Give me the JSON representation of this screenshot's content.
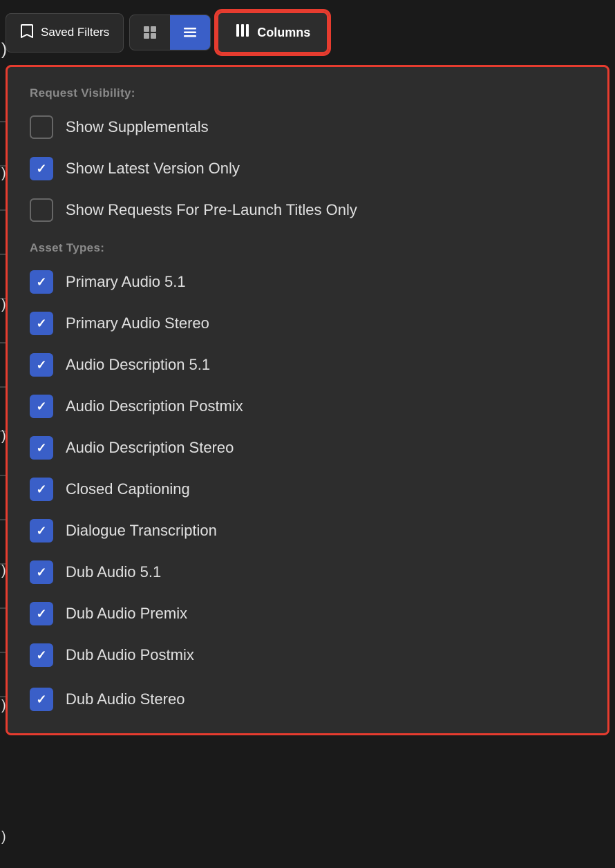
{
  "topBar": {
    "savedFiltersLabel": "Saved Filters",
    "columnsLabel": "Columns"
  },
  "panel": {
    "requestVisibility": {
      "sectionTitle": "Request Visibility:",
      "items": [
        {
          "id": "show-supplementals",
          "label": "Show Supplementals",
          "checked": false
        },
        {
          "id": "show-latest-version",
          "label": "Show Latest Version Only",
          "checked": true
        },
        {
          "id": "show-pre-launch",
          "label": "Show Requests For Pre-Launch Titles Only",
          "checked": false
        }
      ]
    },
    "assetTypes": {
      "sectionTitle": "Asset Types:",
      "items": [
        {
          "id": "primary-audio-51",
          "label": "Primary Audio 5.1",
          "checked": true
        },
        {
          "id": "primary-audio-stereo",
          "label": "Primary Audio Stereo",
          "checked": true
        },
        {
          "id": "audio-desc-51",
          "label": "Audio Description 5.1",
          "checked": true
        },
        {
          "id": "audio-desc-postmix",
          "label": "Audio Description Postmix",
          "checked": true
        },
        {
          "id": "audio-desc-stereo",
          "label": "Audio Description Stereo",
          "checked": true
        },
        {
          "id": "closed-captioning",
          "label": "Closed Captioning",
          "checked": true
        },
        {
          "id": "dialogue-transcription",
          "label": "Dialogue Transcription",
          "checked": true
        },
        {
          "id": "dub-audio-51",
          "label": "Dub Audio 5.1",
          "checked": true
        },
        {
          "id": "dub-audio-premix",
          "label": "Dub Audio Premix",
          "checked": true
        },
        {
          "id": "dub-audio-postmix",
          "label": "Dub Audio Postmix",
          "checked": true
        },
        {
          "id": "dub-audio-stereo",
          "label": "Dub Audio Stereo",
          "checked": true
        }
      ]
    }
  },
  "icons": {
    "bookmark": "🔖",
    "checkmark": "✓",
    "columns": "|||"
  }
}
